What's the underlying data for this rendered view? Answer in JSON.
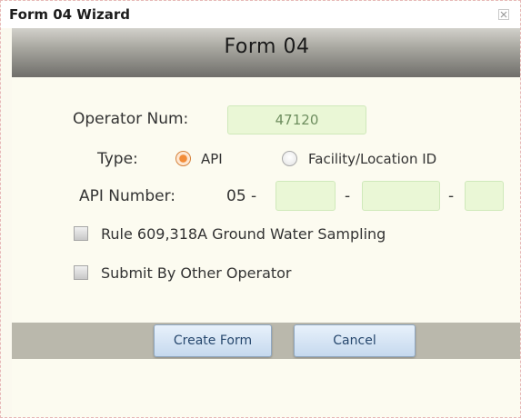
{
  "window": {
    "title": "Form 04 Wizard",
    "close_icon": "close-icon"
  },
  "header": {
    "title": "Form 04"
  },
  "form": {
    "operator_label": "Operator Num:",
    "operator_value": "47120",
    "type_label": "Type:",
    "type_options": [
      {
        "label": "API",
        "selected": true
      },
      {
        "label": "Facility/Location ID",
        "selected": false
      }
    ],
    "api_label": "API Number:",
    "api_prefix": "05 -",
    "api_dash_1": "-",
    "api_dash_2": "-",
    "api_part1": "",
    "api_part2": "",
    "api_part3": "",
    "checkbox_rule": {
      "label": "Rule 609,318A Ground Water Sampling",
      "checked": false
    },
    "checkbox_other": {
      "label": "Submit By Other Operator",
      "checked": false
    }
  },
  "buttons": {
    "create": "Create Form",
    "cancel": "Cancel"
  },
  "colors": {
    "field_bg": "#eaf7d6",
    "radio_selected": "#f28c38",
    "button_text": "#27486e"
  }
}
